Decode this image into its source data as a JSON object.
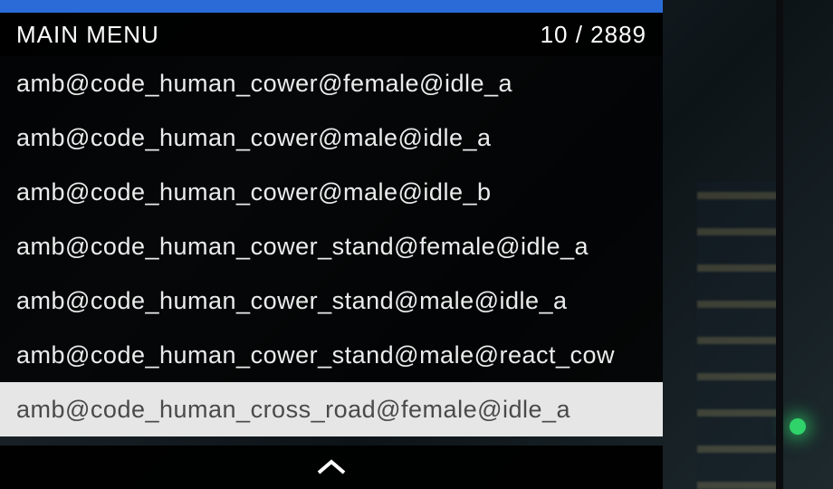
{
  "header": {
    "title": "MAIN MENU",
    "counter": "10 / 2889"
  },
  "menu": {
    "items": [
      {
        "label": "amb@code_human_cower@female@idle_a",
        "selected": false
      },
      {
        "label": "amb@code_human_cower@male@idle_a",
        "selected": false
      },
      {
        "label": "amb@code_human_cower@male@idle_b",
        "selected": false
      },
      {
        "label": "amb@code_human_cower_stand@female@idle_a",
        "selected": false
      },
      {
        "label": "amb@code_human_cower_stand@male@idle_a",
        "selected": false
      },
      {
        "label": "amb@code_human_cower_stand@male@react_cow",
        "selected": false
      },
      {
        "label": "amb@code_human_cross_road@female@idle_a",
        "selected": true
      }
    ]
  },
  "icons": {
    "chevron_up": "chevron-up-icon"
  },
  "colors": {
    "accent_blue": "#2a6bd8",
    "panel_black": "#000000",
    "text_light": "#ececec",
    "selected_bg": "#e6e6e6",
    "selected_text": "#4a4a4a"
  }
}
